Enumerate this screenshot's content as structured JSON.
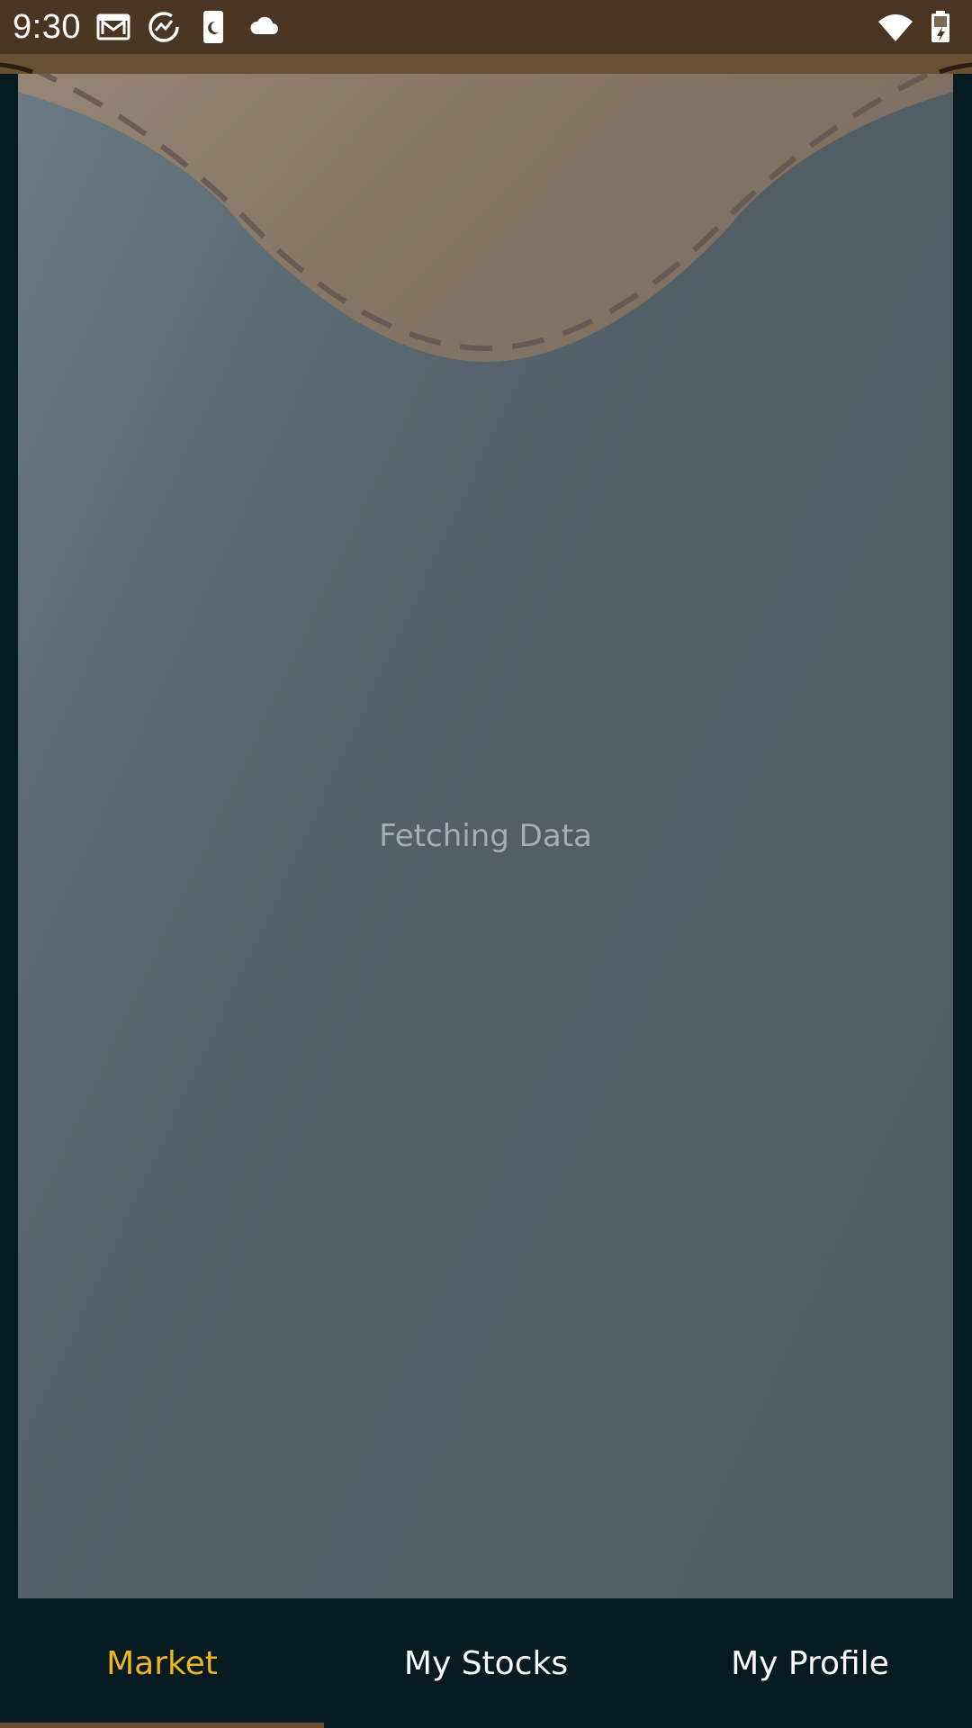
{
  "status_bar": {
    "time": "9:30",
    "left_icons": [
      "gmail-icon",
      "sync-chart-icon",
      "phone-moon-icon",
      "cloud-icon"
    ],
    "right_icons": [
      "wifi-icon",
      "battery-icon"
    ]
  },
  "main": {
    "loading_text": "Fetching Data"
  },
  "bottom_nav": {
    "tabs": [
      {
        "label": "Market",
        "active": true
      },
      {
        "label": "My Stocks",
        "active": false
      },
      {
        "label": "My Profile",
        "active": false
      }
    ]
  },
  "colors": {
    "status_bar_bg": "#4a3522",
    "app_bg": "#061a22",
    "accent_active": "#f0b41c",
    "header_wave": "#8a7866",
    "card_bg": "#525d64"
  }
}
